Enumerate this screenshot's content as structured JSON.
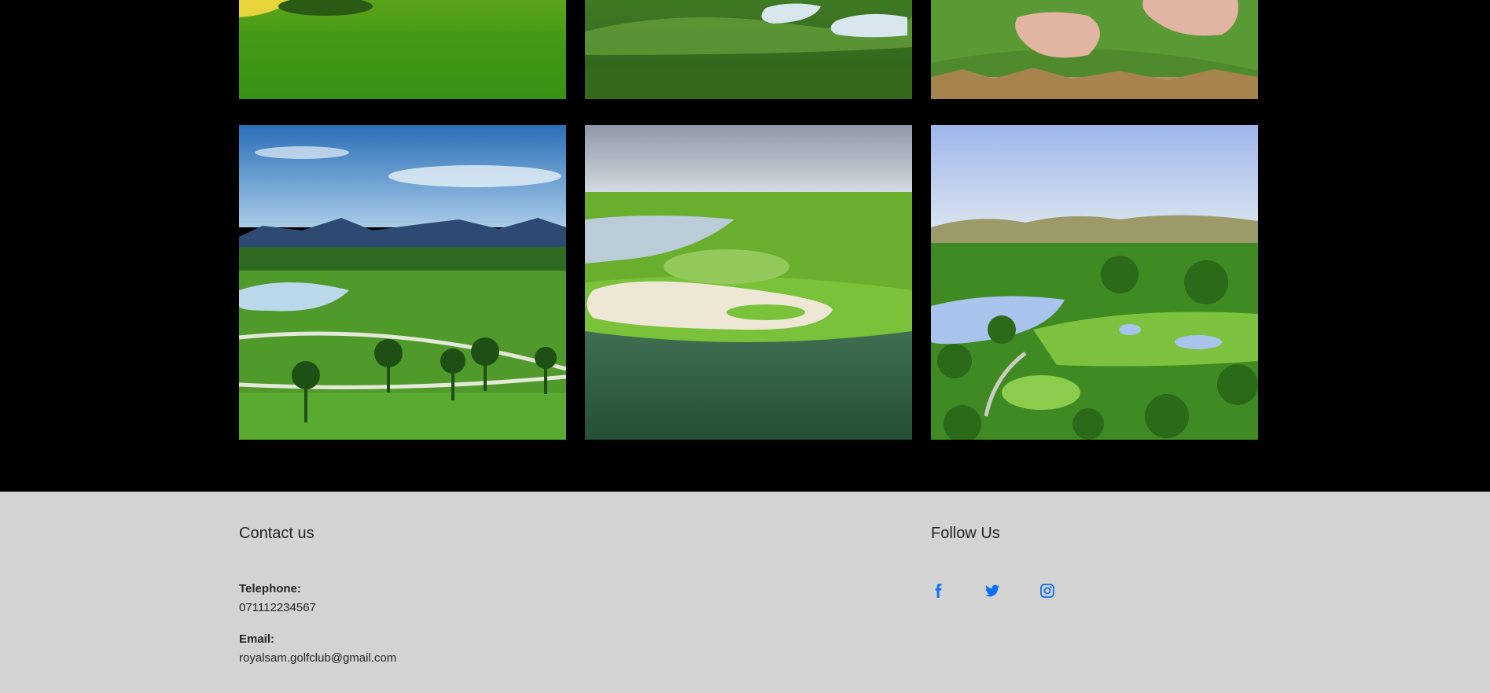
{
  "footer": {
    "contact": {
      "heading": "Contact us",
      "telephone_label": "Telephone:",
      "telephone_value": "071112234567",
      "email_label": "Email:",
      "email_value": "royalsam.golfclub@gmail.com"
    },
    "follow": {
      "heading": "Follow Us",
      "links": [
        {
          "icon": "facebook-icon"
        },
        {
          "icon": "twitter-icon"
        },
        {
          "icon": "instagram-icon"
        }
      ]
    }
  },
  "colors": {
    "gallery_bg": "#000000",
    "footer_bg": "#d3d3d3",
    "social_icon": "#0d6efd",
    "text": "#212529"
  }
}
